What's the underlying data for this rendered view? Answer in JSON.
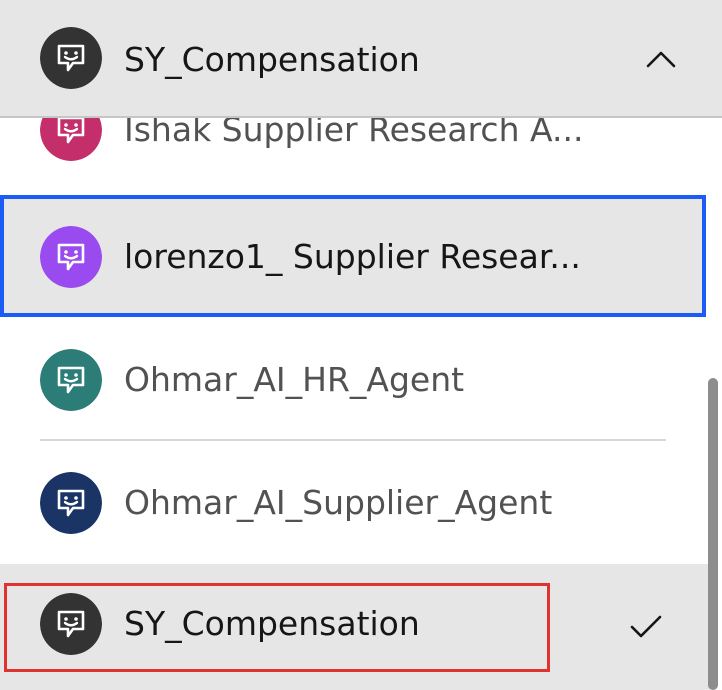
{
  "dropdown": {
    "selected_label": "SY_Compensation",
    "selected_avatar_color": "#333333",
    "expanded": true
  },
  "options": [
    {
      "label": "Ishak Supplier Research A...",
      "avatar_color": "#c42f6b",
      "icon": "chat-bot-icon"
    },
    {
      "label": "lorenzo1_ Supplier Resear...",
      "avatar_color": "#9a4bf0",
      "icon": "chat-bot-icon",
      "focused": true
    },
    {
      "label": "Ohmar_AI_HR_Agent",
      "avatar_color": "#2c7c77",
      "icon": "chat-bot-icon"
    },
    {
      "label": "Ohmar_AI_Supplier_Agent",
      "avatar_color": "#1a3466",
      "icon": "chat-bot-icon"
    },
    {
      "label": "SY_Compensation",
      "avatar_color": "#333333",
      "icon": "chat-bot-icon",
      "selected": true
    }
  ],
  "colors": {
    "focus_border": "#1a5cf5",
    "highlight_box": "#e0322f",
    "header_bg": "#e6e6e6"
  },
  "icons": {
    "collapse": "chevron-up-icon",
    "selected": "checkmark-icon"
  }
}
